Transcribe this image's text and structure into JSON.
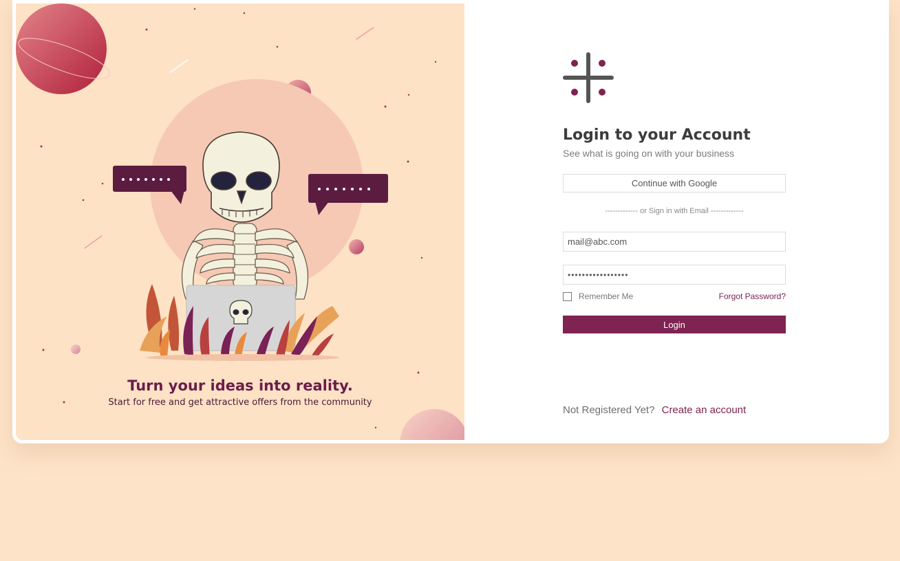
{
  "illustration": {
    "headline": "Turn your ideas into reality.",
    "subline": "Start for free and get attractive offers from the community"
  },
  "login": {
    "title": "Login to your Account",
    "subtitle": "See what is going on with your business",
    "google_button": "Continue with Google",
    "divider": "------------- or Sign in with Email -------------",
    "email_value": "mail@abc.com",
    "password_value": "•••••••••••••••••",
    "remember_label": "Remember Me",
    "forgot_label": "Forgot Password?",
    "login_button": "Login",
    "register_prompt": "Not Registered Yet?",
    "register_link": "Create an account"
  },
  "colors": {
    "accent": "#7e2352",
    "background": "#fde3c8",
    "panel": "#fde2c6"
  },
  "icons": [
    "app-logo-icon",
    "checkbox-icon",
    "skeleton-illustration",
    "speech-bubble-icon"
  ]
}
